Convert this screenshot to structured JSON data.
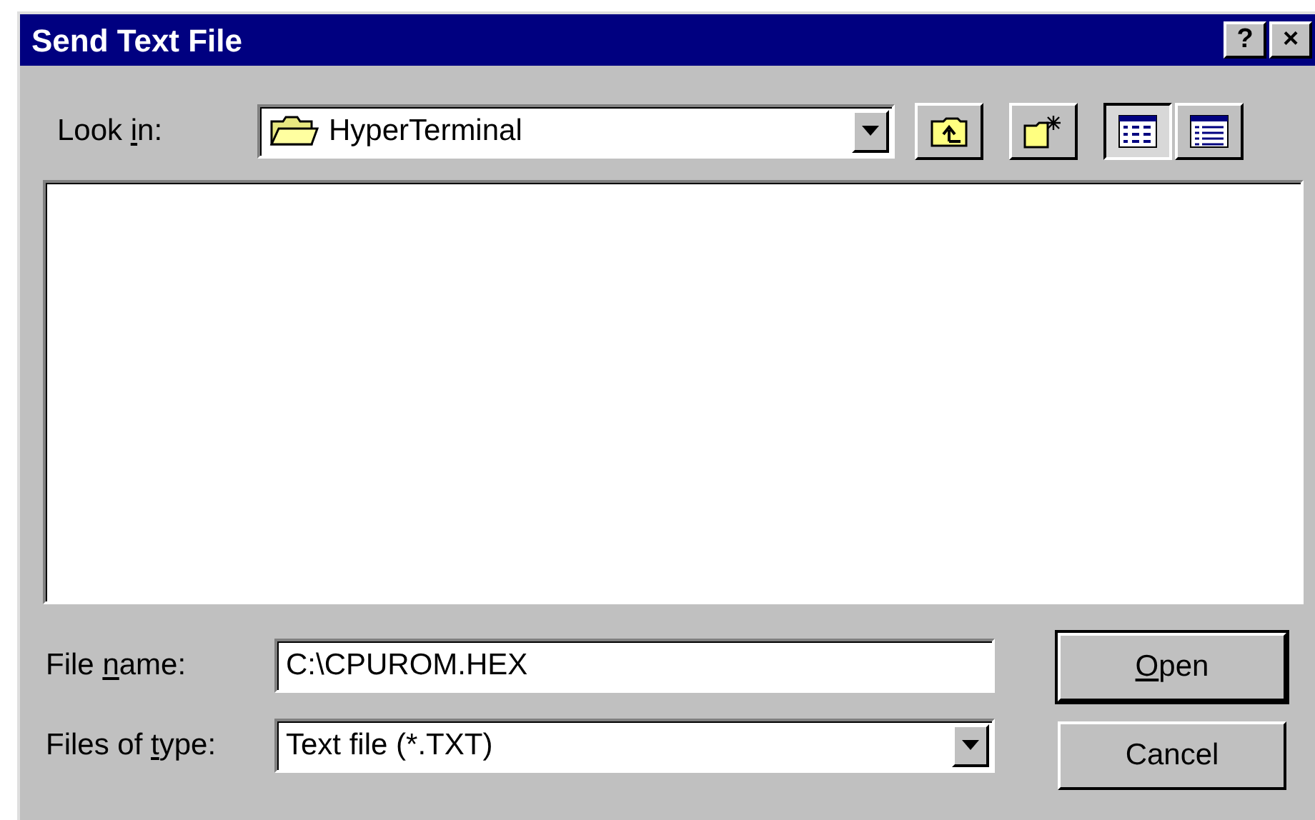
{
  "window": {
    "title": "Send Text File",
    "title_buttons": [
      "?",
      "×"
    ]
  },
  "look_in": {
    "label": {
      "before": "Look ",
      "key": "i",
      "after": "n:"
    },
    "value": "HyperTerminal"
  },
  "toolbar": [
    {
      "kind": "up",
      "selected": false
    },
    {
      "kind": "newfolder",
      "selected": false
    },
    {
      "kind": "list",
      "selected": true
    },
    {
      "kind": "details",
      "selected": false
    }
  ],
  "file_name": {
    "label": {
      "before": "File ",
      "key": "n",
      "after": "ame:"
    },
    "value": "C:\\CPUROM.HEX"
  },
  "file_type": {
    "label": {
      "before": "Files of ",
      "key": "t",
      "after": "ype:"
    },
    "value": "Text file (*.TXT)"
  },
  "buttons": [
    {
      "label": {
        "key": "O",
        "after": "pen"
      },
      "default": true
    },
    {
      "label": {
        "before": "Cancel"
      },
      "default": false
    }
  ]
}
